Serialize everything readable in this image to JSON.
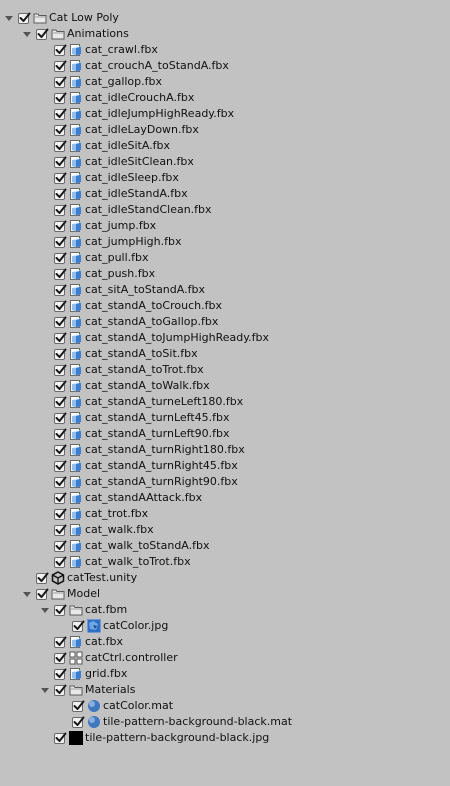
{
  "tree": [
    {
      "label": "Cat Low Poly",
      "icon": "folder-icon",
      "depth": 0,
      "foldout": "expanded",
      "checked": true
    },
    {
      "label": "Animations",
      "icon": "folder-icon",
      "depth": 1,
      "foldout": "expanded",
      "checked": true
    },
    {
      "label": "cat_crawl.fbx",
      "icon": "fbx-model-icon",
      "depth": 2,
      "foldout": "none",
      "checked": true
    },
    {
      "label": "cat_crouchA_toStandA.fbx",
      "icon": "fbx-model-icon",
      "depth": 2,
      "foldout": "none",
      "checked": true
    },
    {
      "label": "cat_gallop.fbx",
      "icon": "fbx-model-icon",
      "depth": 2,
      "foldout": "none",
      "checked": true
    },
    {
      "label": "cat_idleCrouchA.fbx",
      "icon": "fbx-model-icon",
      "depth": 2,
      "foldout": "none",
      "checked": true
    },
    {
      "label": "cat_idleJumpHighReady.fbx",
      "icon": "fbx-model-icon",
      "depth": 2,
      "foldout": "none",
      "checked": true
    },
    {
      "label": "cat_idleLayDown.fbx",
      "icon": "fbx-model-icon",
      "depth": 2,
      "foldout": "none",
      "checked": true
    },
    {
      "label": "cat_idleSitA.fbx",
      "icon": "fbx-model-icon",
      "depth": 2,
      "foldout": "none",
      "checked": true
    },
    {
      "label": "cat_idleSitClean.fbx",
      "icon": "fbx-model-icon",
      "depth": 2,
      "foldout": "none",
      "checked": true
    },
    {
      "label": "cat_idleSleep.fbx",
      "icon": "fbx-model-icon",
      "depth": 2,
      "foldout": "none",
      "checked": true
    },
    {
      "label": "cat_idleStandA.fbx",
      "icon": "fbx-model-icon",
      "depth": 2,
      "foldout": "none",
      "checked": true
    },
    {
      "label": "cat_idleStandClean.fbx",
      "icon": "fbx-model-icon",
      "depth": 2,
      "foldout": "none",
      "checked": true
    },
    {
      "label": "cat_jump.fbx",
      "icon": "fbx-model-icon",
      "depth": 2,
      "foldout": "none",
      "checked": true
    },
    {
      "label": "cat_jumpHigh.fbx",
      "icon": "fbx-model-icon",
      "depth": 2,
      "foldout": "none",
      "checked": true
    },
    {
      "label": "cat_pull.fbx",
      "icon": "fbx-model-icon",
      "depth": 2,
      "foldout": "none",
      "checked": true
    },
    {
      "label": "cat_push.fbx",
      "icon": "fbx-model-icon",
      "depth": 2,
      "foldout": "none",
      "checked": true
    },
    {
      "label": "cat_sitA_toStandA.fbx",
      "icon": "fbx-model-icon",
      "depth": 2,
      "foldout": "none",
      "checked": true
    },
    {
      "label": "cat_standA_toCrouch.fbx",
      "icon": "fbx-model-icon",
      "depth": 2,
      "foldout": "none",
      "checked": true
    },
    {
      "label": "cat_standA_toGallop.fbx",
      "icon": "fbx-model-icon",
      "depth": 2,
      "foldout": "none",
      "checked": true
    },
    {
      "label": "cat_standA_toJumpHighReady.fbx",
      "icon": "fbx-model-icon",
      "depth": 2,
      "foldout": "none",
      "checked": true
    },
    {
      "label": "cat_standA_toSit.fbx",
      "icon": "fbx-model-icon",
      "depth": 2,
      "foldout": "none",
      "checked": true
    },
    {
      "label": "cat_standA_toTrot.fbx",
      "icon": "fbx-model-icon",
      "depth": 2,
      "foldout": "none",
      "checked": true
    },
    {
      "label": "cat_standA_toWalk.fbx",
      "icon": "fbx-model-icon",
      "depth": 2,
      "foldout": "none",
      "checked": true
    },
    {
      "label": "cat_standA_turneLeft180.fbx",
      "icon": "fbx-model-icon",
      "depth": 2,
      "foldout": "none",
      "checked": true
    },
    {
      "label": "cat_standA_turnLeft45.fbx",
      "icon": "fbx-model-icon",
      "depth": 2,
      "foldout": "none",
      "checked": true
    },
    {
      "label": "cat_standA_turnLeft90.fbx",
      "icon": "fbx-model-icon",
      "depth": 2,
      "foldout": "none",
      "checked": true
    },
    {
      "label": "cat_standA_turnRight180.fbx",
      "icon": "fbx-model-icon",
      "depth": 2,
      "foldout": "none",
      "checked": true
    },
    {
      "label": "cat_standA_turnRight45.fbx",
      "icon": "fbx-model-icon",
      "depth": 2,
      "foldout": "none",
      "checked": true
    },
    {
      "label": "cat_standA_turnRight90.fbx",
      "icon": "fbx-model-icon",
      "depth": 2,
      "foldout": "none",
      "checked": true
    },
    {
      "label": "cat_standAAttack.fbx",
      "icon": "fbx-model-icon",
      "depth": 2,
      "foldout": "none",
      "checked": true
    },
    {
      "label": "cat_trot.fbx",
      "icon": "fbx-model-icon",
      "depth": 2,
      "foldout": "none",
      "checked": true
    },
    {
      "label": "cat_walk.fbx",
      "icon": "fbx-model-icon",
      "depth": 2,
      "foldout": "none",
      "checked": true
    },
    {
      "label": "cat_walk_toStandA.fbx",
      "icon": "fbx-model-icon",
      "depth": 2,
      "foldout": "none",
      "checked": true
    },
    {
      "label": "cat_walk_toTrot.fbx",
      "icon": "fbx-model-icon",
      "depth": 2,
      "foldout": "none",
      "checked": true
    },
    {
      "label": "catTest.unity",
      "icon": "unity-scene-icon",
      "depth": 1,
      "foldout": "none",
      "checked": true
    },
    {
      "label": "Model",
      "icon": "folder-icon",
      "depth": 1,
      "foldout": "expanded",
      "checked": true
    },
    {
      "label": "cat.fbm",
      "icon": "folder-icon",
      "depth": 2,
      "foldout": "expanded",
      "checked": true
    },
    {
      "label": "catColor.jpg",
      "icon": "texture-icon",
      "depth": 3,
      "foldout": "none",
      "checked": true
    },
    {
      "label": "cat.fbx",
      "icon": "fbx-model-icon",
      "depth": 2,
      "foldout": "none",
      "checked": true
    },
    {
      "label": "catCtrl.controller",
      "icon": "animator-controller-icon",
      "depth": 2,
      "foldout": "none",
      "checked": true
    },
    {
      "label": "grid.fbx",
      "icon": "fbx-model-icon",
      "depth": 2,
      "foldout": "none",
      "checked": true
    },
    {
      "label": "Materials",
      "icon": "folder-icon",
      "depth": 2,
      "foldout": "expanded",
      "checked": true
    },
    {
      "label": "catColor.mat",
      "icon": "material-sphere-icon",
      "depth": 3,
      "foldout": "none",
      "checked": true
    },
    {
      "label": "tile-pattern-background-black.mat",
      "icon": "material-sphere-icon",
      "depth": 3,
      "foldout": "none",
      "checked": true
    },
    {
      "label": "tile-pattern-background-black.jpg",
      "icon": "black-texture-icon",
      "depth": 2,
      "foldout": "none",
      "checked": true
    }
  ],
  "colors": {
    "background": "#c2c2c2",
    "checkmark": "#1a1a1a",
    "fbx_blue": "#7fb2e6",
    "folder": "#e8e8e8",
    "texture_blue": "#2f6fc2"
  }
}
